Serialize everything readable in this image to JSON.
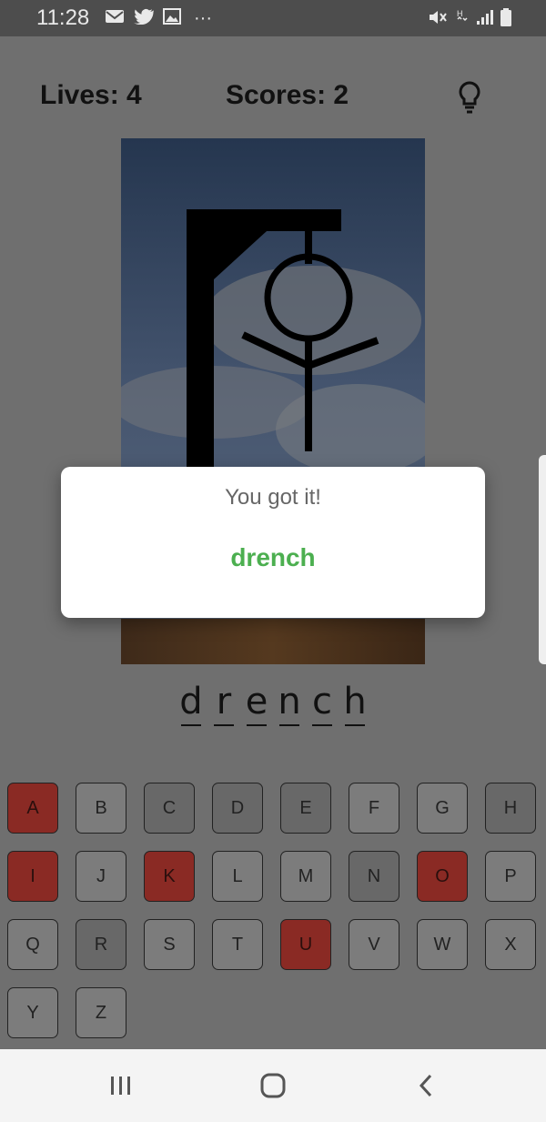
{
  "status_bar": {
    "time": "11:28",
    "icons": [
      "mail-icon",
      "twitter-icon",
      "gallery-icon",
      "more-icon",
      "mute-icon",
      "data-icon",
      "signal-icon",
      "battery-icon"
    ],
    "overflow_glyph": "···"
  },
  "header": {
    "lives_label": "Lives: 4",
    "scores_label": "Scores: 2",
    "hint_icon": "lightbulb-icon"
  },
  "word": {
    "letters": [
      "d",
      "r",
      "e",
      "n",
      "c",
      "h"
    ]
  },
  "keyboard": {
    "keys": [
      {
        "label": "A",
        "state": "wrong"
      },
      {
        "label": "B",
        "state": "unused"
      },
      {
        "label": "C",
        "state": "used"
      },
      {
        "label": "D",
        "state": "used"
      },
      {
        "label": "E",
        "state": "used"
      },
      {
        "label": "F",
        "state": "unused"
      },
      {
        "label": "G",
        "state": "unused"
      },
      {
        "label": "H",
        "state": "used"
      },
      {
        "label": "I",
        "state": "wrong"
      },
      {
        "label": "J",
        "state": "unused"
      },
      {
        "label": "K",
        "state": "wrong"
      },
      {
        "label": "L",
        "state": "unused"
      },
      {
        "label": "M",
        "state": "unused"
      },
      {
        "label": "N",
        "state": "used"
      },
      {
        "label": "O",
        "state": "wrong"
      },
      {
        "label": "P",
        "state": "unused"
      },
      {
        "label": "Q",
        "state": "unused"
      },
      {
        "label": "R",
        "state": "used"
      },
      {
        "label": "S",
        "state": "unused"
      },
      {
        "label": "T",
        "state": "unused"
      },
      {
        "label": "U",
        "state": "wrong"
      },
      {
        "label": "V",
        "state": "unused"
      },
      {
        "label": "W",
        "state": "unused"
      },
      {
        "label": "X",
        "state": "unused"
      },
      {
        "label": "Y",
        "state": "unused"
      },
      {
        "label": "Z",
        "state": "unused"
      }
    ]
  },
  "dialog": {
    "title": "You got it!",
    "answer": "drench"
  },
  "nav_bar": {
    "buttons": [
      "recent-apps-icon",
      "home-icon",
      "back-icon"
    ]
  },
  "colors": {
    "answer_green": "#4caf50",
    "wrong_key_red": "#8a2a24",
    "overlay_gray": "#6f6f6f"
  }
}
